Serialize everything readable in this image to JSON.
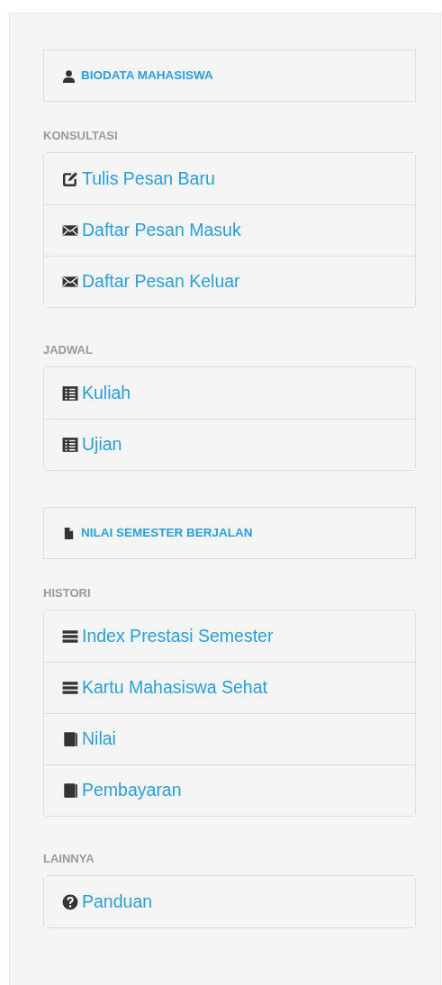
{
  "sections": [
    {
      "kind": "box",
      "label": "BIODATA MAHASISWA"
    },
    {
      "kind": "group",
      "heading": "KONSULTASI",
      "items": [
        {
          "label": "Tulis Pesan Baru"
        },
        {
          "label": "Daftar Pesan Masuk"
        },
        {
          "label": "Daftar Pesan Keluar"
        }
      ]
    },
    {
      "kind": "group",
      "heading": "JADWAL",
      "items": [
        {
          "label": "Kuliah"
        },
        {
          "label": "Ujian"
        }
      ]
    },
    {
      "kind": "box",
      "label": "NILAI SEMESTER BERJALAN"
    },
    {
      "kind": "group",
      "heading": "HISTORI",
      "items": [
        {
          "label": "Index Prestasi Semester"
        },
        {
          "label": "Kartu Mahasiswa Sehat"
        },
        {
          "label": "Nilai"
        },
        {
          "label": "Pembayaran"
        }
      ]
    },
    {
      "kind": "group",
      "heading": "LAINNYA",
      "items": [
        {
          "label": "Panduan"
        }
      ]
    }
  ]
}
